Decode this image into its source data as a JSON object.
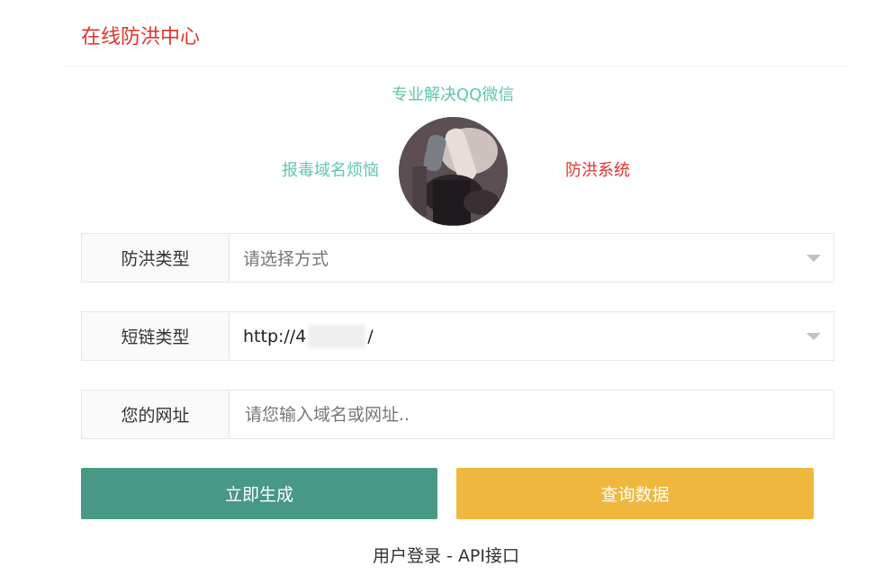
{
  "header": {
    "title": "在线防洪中心"
  },
  "banner": {
    "top_tag": "专业解决QQ微信",
    "left_tag": "报毒域名烦恼",
    "right_tag": "防洪系统",
    "colors": {
      "teal": "#5fc6ae",
      "red": "#e0342a"
    }
  },
  "form": {
    "type_field": {
      "label": "防洪类型",
      "placeholder": "请选择方式"
    },
    "link_type_field": {
      "label": "短链类型",
      "value_prefix": "http://4",
      "value_suffix": "/"
    },
    "url_field": {
      "label": "您的网址",
      "placeholder": "请您输入域名或网址.."
    }
  },
  "actions": {
    "generate_label": "立即生成",
    "query_label": "查询数据",
    "generate_color": "#479885",
    "query_color": "#f0b73e"
  },
  "footer": {
    "login_label": "用户登录",
    "separator": " - ",
    "api_label": "API接口"
  }
}
